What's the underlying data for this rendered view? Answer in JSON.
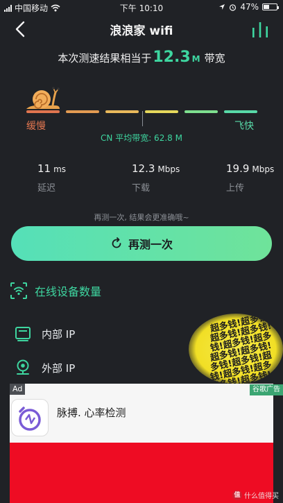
{
  "status_bar": {
    "carrier": "中国移动",
    "time": "下午 10:10",
    "battery": "47%",
    "battery_level": 0.47
  },
  "nav": {
    "title": "浪浪家 wifi"
  },
  "result": {
    "prefix": "本次测速结果相当于",
    "speed_value": "12.3",
    "speed_unit": "M",
    "suffix": "带宽"
  },
  "scale": {
    "slow_label": "缓慢",
    "fast_label": "飞快",
    "segment_colors": [
      "#e0754f",
      "#e39b52",
      "#e9b95b",
      "#e6d85c",
      "#7ee08f",
      "#58d9a8"
    ],
    "cn_average": "CN 平均带宽: 62.8 M"
  },
  "metrics": [
    {
      "value": "11",
      "unit": "ms",
      "label": "延迟"
    },
    {
      "value": "12.3",
      "unit": "Mbps",
      "label": "下载"
    },
    {
      "value": "19.9",
      "unit": "Mbps",
      "label": "上传"
    }
  ],
  "hint": "再测一次, 结果会更准确哦~",
  "retest_label": "再测一次",
  "device_count_label": "在线设备数量",
  "ip_rows": [
    {
      "label": "内部 IP"
    },
    {
      "label": "外部 IP"
    }
  ],
  "sticker": {
    "lines": [
      "超多钱!超多钱!",
      "超多钱!超多钱!",
      "钱!超多钱!超多",
      "超多钱!超多钱!",
      "多钱!超多钱!超",
      "钱!超多钱!超多",
      "超多钱!超多钱!"
    ]
  },
  "ad": {
    "badge": "Ad",
    "provider": "谷歌广告",
    "title": "脉搏. 心率检测"
  },
  "watermark": {
    "logo": "值",
    "text": "什么值得买"
  },
  "colors": {
    "accent": "#3ed6a0",
    "background": "#202226",
    "ad_banner": "#ee0c23"
  }
}
